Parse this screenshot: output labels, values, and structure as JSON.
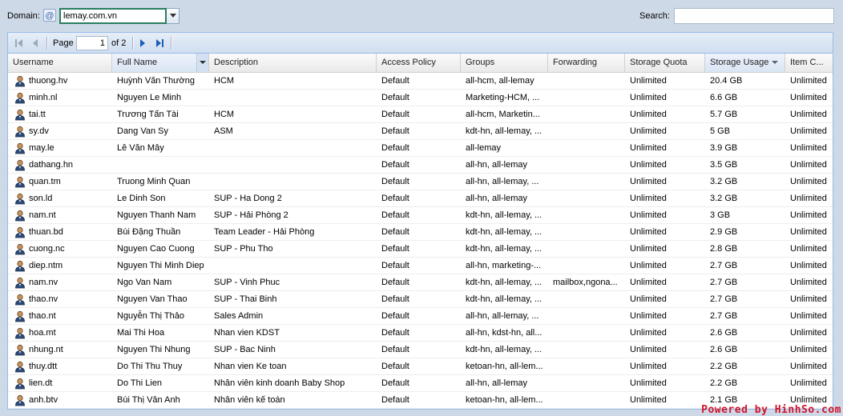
{
  "topbar": {
    "domain_label": "Domain:",
    "domain_value": "lemay.com.vn",
    "search_label": "Search:",
    "search_value": ""
  },
  "pager": {
    "page_label": "Page",
    "page_value": "1",
    "of_label": "of 2"
  },
  "columns": [
    {
      "key": "username",
      "label": "Username"
    },
    {
      "key": "fullname",
      "label": "Full Name"
    },
    {
      "key": "description",
      "label": "Description"
    },
    {
      "key": "access_policy",
      "label": "Access Policy"
    },
    {
      "key": "groups",
      "label": "Groups"
    },
    {
      "key": "forwarding",
      "label": "Forwarding"
    },
    {
      "key": "storage_quota",
      "label": "Storage Quota"
    },
    {
      "key": "storage_usage",
      "label": "Storage Usage"
    },
    {
      "key": "item_count",
      "label": "Item C..."
    }
  ],
  "rows": [
    {
      "username": "thuong.hv",
      "fullname": "Huỳnh Văn Thường",
      "description": "HCM",
      "access_policy": "Default",
      "groups": "all-hcm, all-lemay",
      "forwarding": "",
      "storage_quota": "Unlimited",
      "storage_usage": "20.4 GB",
      "item_count": "Unlimited"
    },
    {
      "username": "minh.nl",
      "fullname": "Nguyen Le Minh",
      "description": "",
      "access_policy": "Default",
      "groups": "Marketing-HCM, ...",
      "forwarding": "",
      "storage_quota": "Unlimited",
      "storage_usage": "6.6 GB",
      "item_count": "Unlimited"
    },
    {
      "username": "tai.tt",
      "fullname": "Trương Tấn Tài",
      "description": "HCM",
      "access_policy": "Default",
      "groups": "all-hcm, Marketin...",
      "forwarding": "",
      "storage_quota": "Unlimited",
      "storage_usage": "5.7 GB",
      "item_count": "Unlimited"
    },
    {
      "username": "sy.dv",
      "fullname": "Dang Van Sy",
      "description": "ASM",
      "access_policy": "Default",
      "groups": "kdt-hn, all-lemay, ...",
      "forwarding": "",
      "storage_quota": "Unlimited",
      "storage_usage": "5 GB",
      "item_count": "Unlimited"
    },
    {
      "username": "may.le",
      "fullname": "Lê Văn Mây",
      "description": "",
      "access_policy": "Default",
      "groups": "all-lemay",
      "forwarding": "",
      "storage_quota": "Unlimited",
      "storage_usage": "3.9 GB",
      "item_count": "Unlimited"
    },
    {
      "username": "dathang.hn",
      "fullname": "",
      "description": "",
      "access_policy": "Default",
      "groups": "all-hn, all-lemay",
      "forwarding": "",
      "storage_quota": "Unlimited",
      "storage_usage": "3.5 GB",
      "item_count": "Unlimited"
    },
    {
      "username": "quan.tm",
      "fullname": "Truong Minh Quan",
      "description": "",
      "access_policy": "Default",
      "groups": "all-hn, all-lemay, ...",
      "forwarding": "",
      "storage_quota": "Unlimited",
      "storage_usage": "3.2 GB",
      "item_count": "Unlimited"
    },
    {
      "username": "son.ld",
      "fullname": "Le Dinh Son",
      "description": "SUP - Ha Dong 2",
      "access_policy": "Default",
      "groups": "all-hn, all-lemay",
      "forwarding": "",
      "storage_quota": "Unlimited",
      "storage_usage": "3.2 GB",
      "item_count": "Unlimited"
    },
    {
      "username": "nam.nt",
      "fullname": "Nguyen Thanh Nam",
      "description": "SUP - Hải Phòng 2",
      "access_policy": "Default",
      "groups": "kdt-hn, all-lemay, ...",
      "forwarding": "",
      "storage_quota": "Unlimited",
      "storage_usage": "3 GB",
      "item_count": "Unlimited"
    },
    {
      "username": "thuan.bd",
      "fullname": "Bùi Đặng Thuần",
      "description": "Team Leader - Hải Phòng",
      "access_policy": "Default",
      "groups": "kdt-hn, all-lemay, ...",
      "forwarding": "",
      "storage_quota": "Unlimited",
      "storage_usage": "2.9 GB",
      "item_count": "Unlimited"
    },
    {
      "username": "cuong.nc",
      "fullname": "Nguyen Cao Cuong",
      "description": "SUP - Phu Tho",
      "access_policy": "Default",
      "groups": "kdt-hn, all-lemay, ...",
      "forwarding": "",
      "storage_quota": "Unlimited",
      "storage_usage": "2.8 GB",
      "item_count": "Unlimited"
    },
    {
      "username": "diep.ntm",
      "fullname": "Nguyen Thi Minh Diep",
      "description": "",
      "access_policy": "Default",
      "groups": "all-hn, marketing-...",
      "forwarding": "",
      "storage_quota": "Unlimited",
      "storage_usage": "2.7 GB",
      "item_count": "Unlimited"
    },
    {
      "username": "nam.nv",
      "fullname": "Ngo Van Nam",
      "description": "SUP - Vinh Phuc",
      "access_policy": "Default",
      "groups": "kdt-hn, all-lemay, ...",
      "forwarding": "mailbox,ngona...",
      "storage_quota": "Unlimited",
      "storage_usage": "2.7 GB",
      "item_count": "Unlimited"
    },
    {
      "username": "thao.nv",
      "fullname": "Nguyen Van Thao",
      "description": "SUP - Thai Binh",
      "access_policy": "Default",
      "groups": "kdt-hn, all-lemay, ...",
      "forwarding": "",
      "storage_quota": "Unlimited",
      "storage_usage": "2.7 GB",
      "item_count": "Unlimited"
    },
    {
      "username": "thao.nt",
      "fullname": "Nguyễn Thị Thảo",
      "description": "Sales Admin",
      "access_policy": "Default",
      "groups": "all-hn, all-lemay, ...",
      "forwarding": "",
      "storage_quota": "Unlimited",
      "storage_usage": "2.7 GB",
      "item_count": "Unlimited"
    },
    {
      "username": "hoa.mt",
      "fullname": "Mai Thi Hoa",
      "description": "Nhan vien KDST",
      "access_policy": "Default",
      "groups": "all-hn, kdst-hn, all...",
      "forwarding": "",
      "storage_quota": "Unlimited",
      "storage_usage": "2.6 GB",
      "item_count": "Unlimited"
    },
    {
      "username": "nhung.nt",
      "fullname": "Nguyen Thi Nhung",
      "description": "SUP - Bac Ninh",
      "access_policy": "Default",
      "groups": "kdt-hn, all-lemay, ...",
      "forwarding": "",
      "storage_quota": "Unlimited",
      "storage_usage": "2.6 GB",
      "item_count": "Unlimited"
    },
    {
      "username": "thuy.dtt",
      "fullname": "Do Thi Thu Thuy",
      "description": "Nhan vien Ke toan",
      "access_policy": "Default",
      "groups": "ketoan-hn, all-lem...",
      "forwarding": "",
      "storage_quota": "Unlimited",
      "storage_usage": "2.2 GB",
      "item_count": "Unlimited"
    },
    {
      "username": "lien.dt",
      "fullname": "Do Thi Lien",
      "description": "Nhân viên kinh doanh Baby Shop",
      "access_policy": "Default",
      "groups": "all-hn, all-lemay",
      "forwarding": "",
      "storage_quota": "Unlimited",
      "storage_usage": "2.2 GB",
      "item_count": "Unlimited"
    },
    {
      "username": "anh.btv",
      "fullname": "Bùi Thị Vân Anh",
      "description": "Nhân viên kế toán",
      "access_policy": "Default",
      "groups": "ketoan-hn, all-lem...",
      "forwarding": "",
      "storage_quota": "Unlimited",
      "storage_usage": "2.1 GB",
      "item_count": "Unlimited"
    }
  ],
  "watermark": "Powered by HinhSo.com",
  "colors": {
    "accent": "#99bbe8",
    "domain_focus": "#2a7d5e",
    "watermark": "#d1142c"
  }
}
